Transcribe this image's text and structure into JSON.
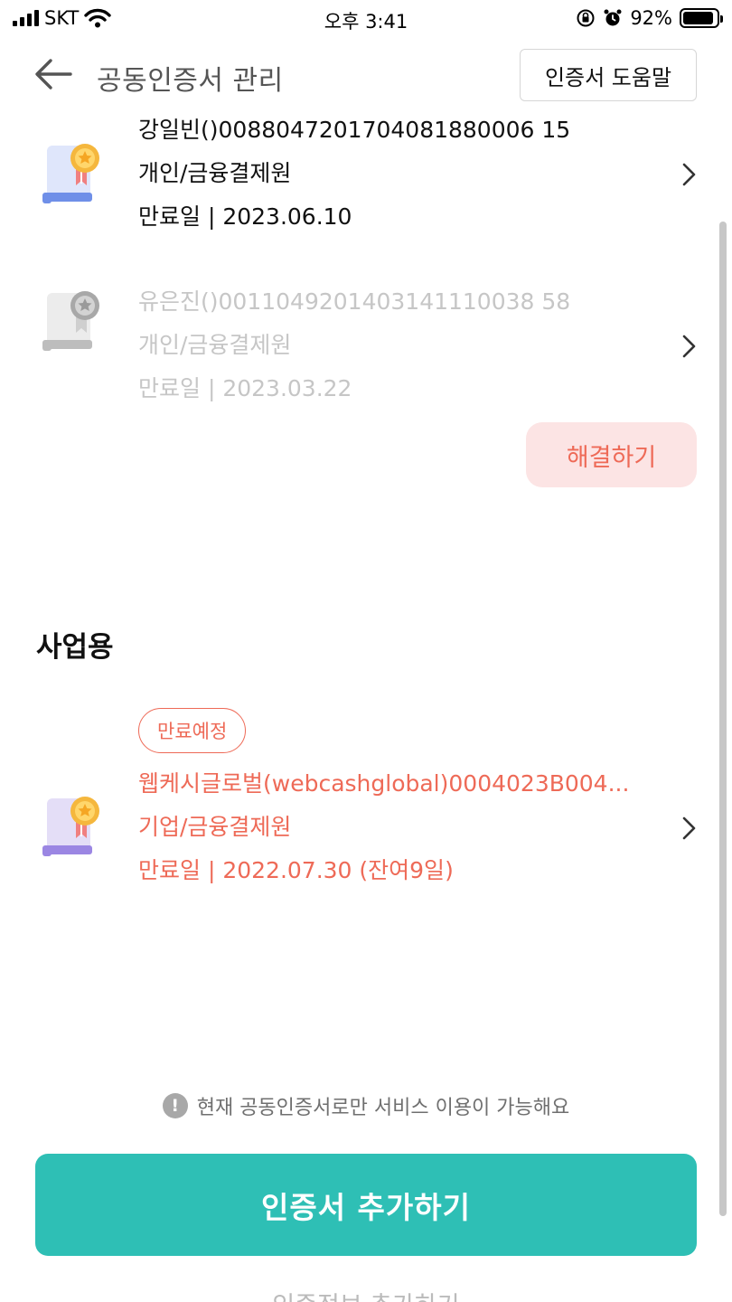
{
  "status_bar": {
    "carrier": "SKT",
    "time": "오후 3:41",
    "battery_pct": "92%",
    "battery_level": 0.92
  },
  "header": {
    "title": "공동인증서 관리",
    "help_button": "인증서 도움말"
  },
  "personal_certs": [
    {
      "name": "강일빈()0088047201704081880006 15",
      "type": "개인/금융결제원",
      "expiry": "만료일 | 2023.06.10",
      "state": "active"
    },
    {
      "name": "유은진()0011049201403141110038 58",
      "type": "개인/금융결제원",
      "expiry": "만료일 | 2023.03.22",
      "state": "disabled"
    }
  ],
  "resolve_button": "해결하기",
  "business_section": {
    "title": "사업용",
    "badge": "만료예정",
    "cert": {
      "name": "웹케시글로벌(webcashglobal)0004023B004...",
      "type": "기업/금융결제원",
      "expiry": "만료일 | 2022.07.30 (잔여9일)"
    }
  },
  "info_note": "현재 공동인증서로만 서비스 이용이 가능해요",
  "add_button": "인증서 추가하기",
  "bottom_link": "인증정보 추가하기",
  "colors": {
    "accent": "#2ebfb5",
    "warning": "#ee6a57",
    "warning_bg": "#fce4e4",
    "disabled_text": "#c6c6c6"
  }
}
